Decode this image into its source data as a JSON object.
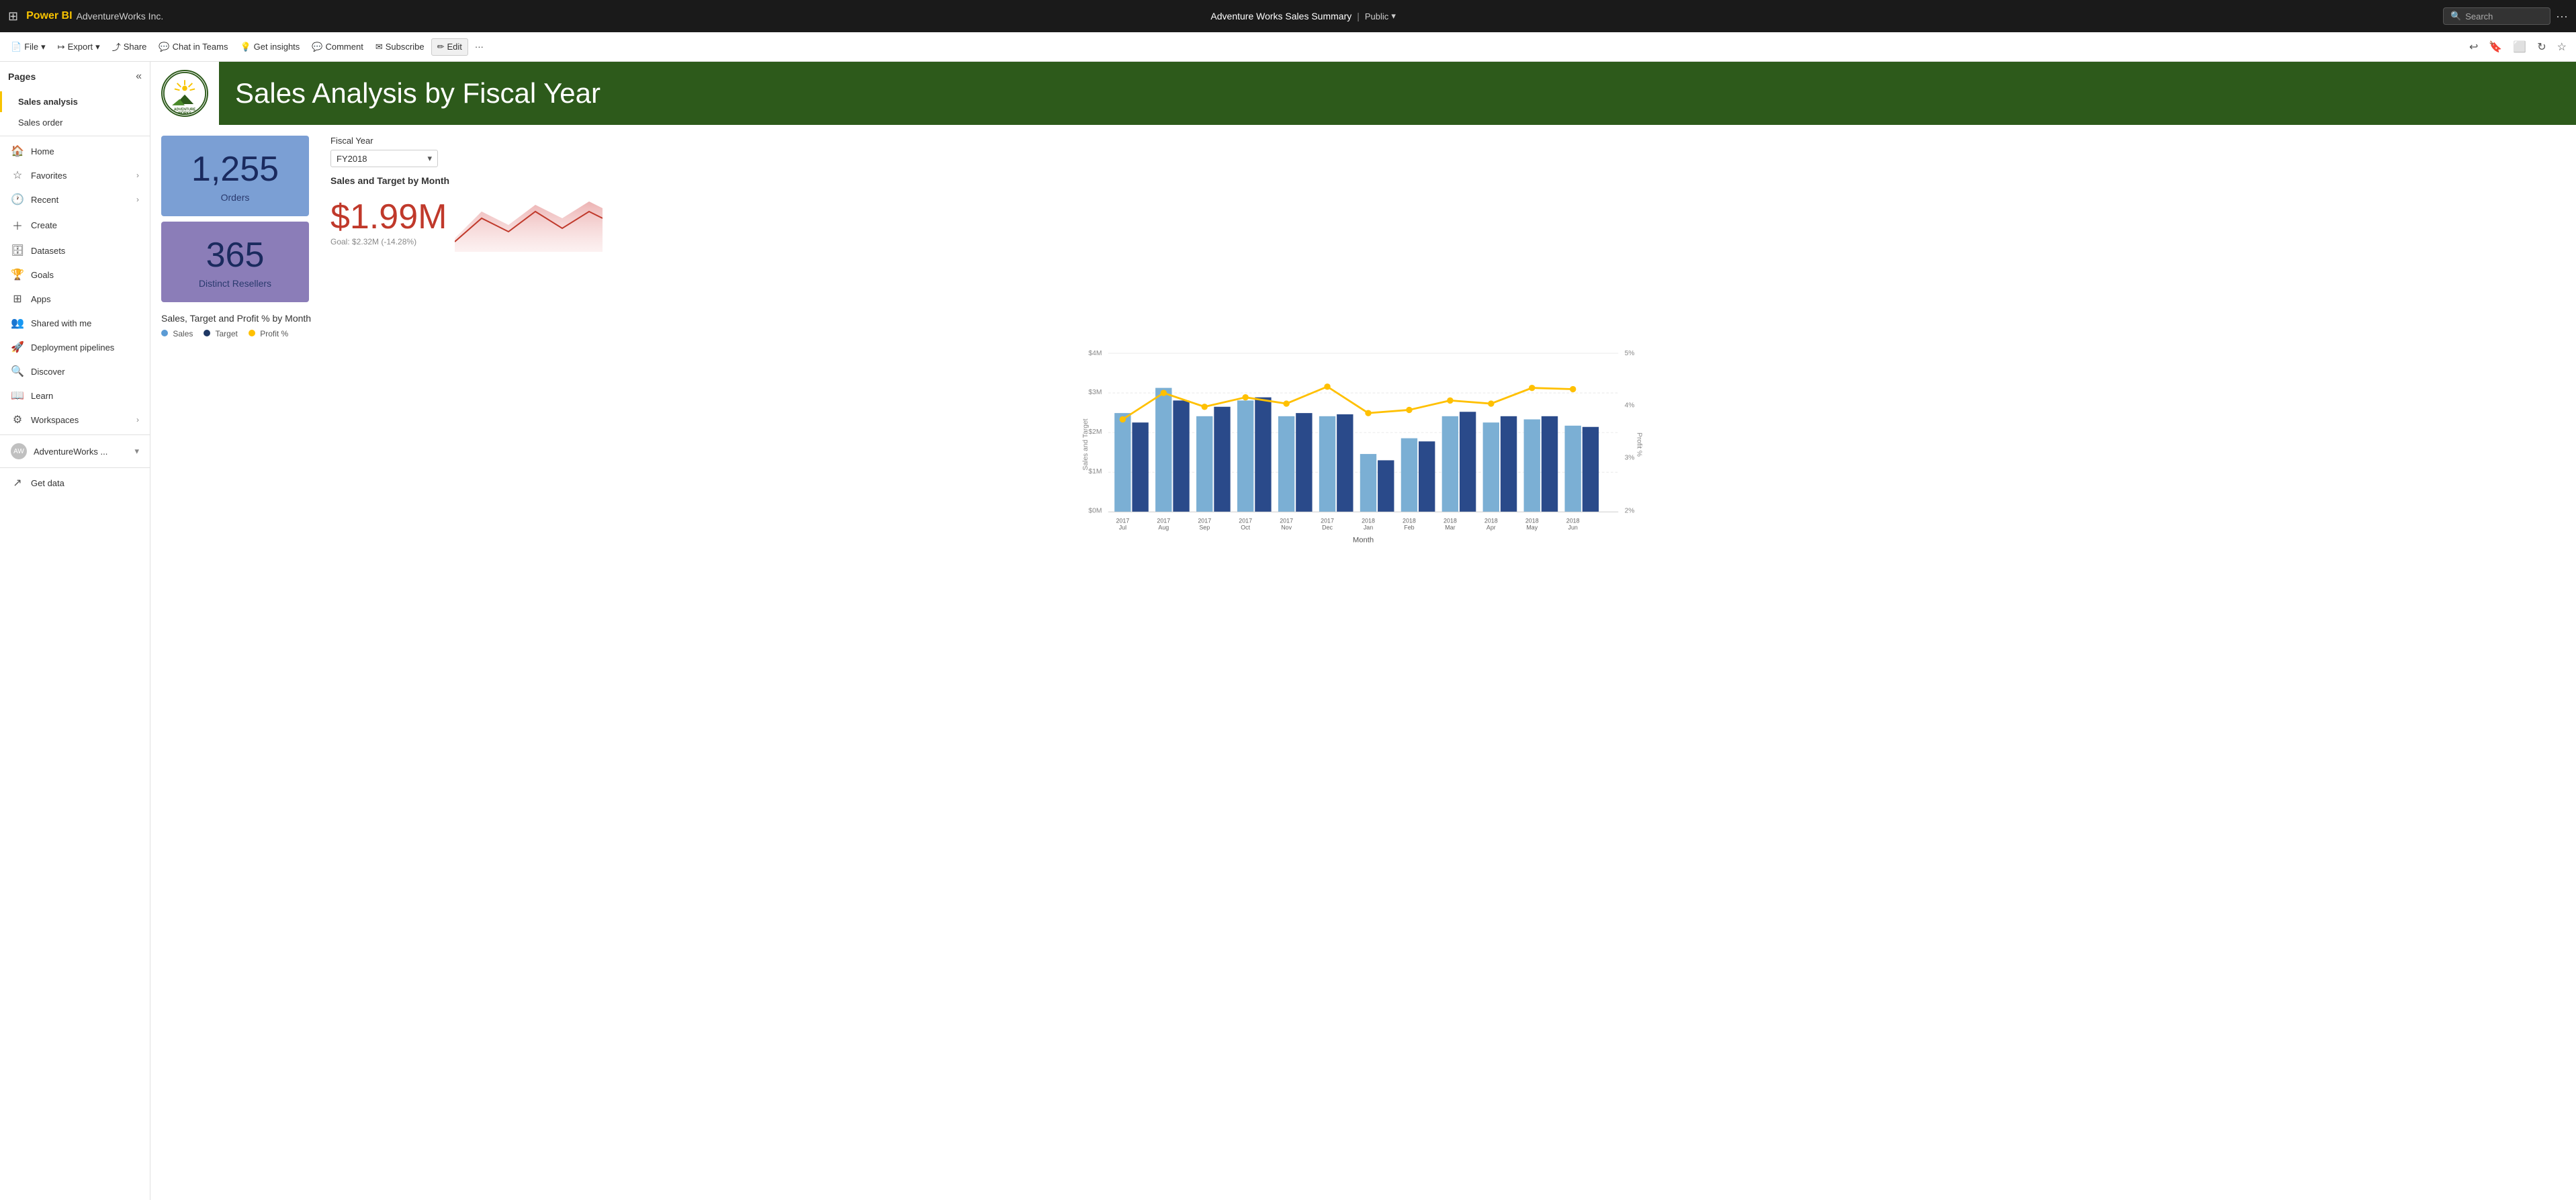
{
  "topbar": {
    "waffle_icon": "⊞",
    "logo_text": "Power BI",
    "org_name": "AdventureWorks Inc.",
    "report_title": "Adventure Works Sales Summary",
    "visibility": "Public",
    "search_placeholder": "Search",
    "more_icon": "···"
  },
  "toolbar": {
    "file_label": "File",
    "export_label": "Export",
    "share_label": "Share",
    "chat_label": "Chat in Teams",
    "insights_label": "Get insights",
    "comment_label": "Comment",
    "subscribe_label": "Subscribe",
    "edit_label": "Edit",
    "more_label": "···"
  },
  "pages_panel": {
    "title": "Pages",
    "pages": [
      {
        "label": "Sales analysis",
        "active": true
      },
      {
        "label": "Sales order",
        "active": false
      }
    ]
  },
  "sidebar": {
    "items": [
      {
        "label": "Home",
        "icon": "🏠",
        "has_arrow": false
      },
      {
        "label": "Favorites",
        "icon": "☆",
        "has_arrow": true
      },
      {
        "label": "Recent",
        "icon": "🕐",
        "has_arrow": true
      },
      {
        "label": "Create",
        "icon": "+",
        "has_arrow": false
      },
      {
        "label": "Datasets",
        "icon": "🗄",
        "has_arrow": false
      },
      {
        "label": "Goals",
        "icon": "🏆",
        "has_arrow": false
      },
      {
        "label": "Apps",
        "icon": "⊞",
        "has_arrow": false
      },
      {
        "label": "Shared with me",
        "icon": "👥",
        "has_arrow": false
      },
      {
        "label": "Deployment pipelines",
        "icon": "🚀",
        "has_arrow": false
      },
      {
        "label": "Discover",
        "icon": "🔍",
        "has_arrow": false
      },
      {
        "label": "Learn",
        "icon": "📖",
        "has_arrow": false
      },
      {
        "label": "Workspaces",
        "icon": "⚙",
        "has_arrow": true
      }
    ],
    "workspace_item": {
      "label": "AdventureWorks ...",
      "has_arrow": true
    },
    "get_data_label": "Get data"
  },
  "report": {
    "header": {
      "logo_text": "ADVENTURE WORKS",
      "title": "Sales Analysis by Fiscal Year"
    },
    "fiscal_year": {
      "label": "Fiscal Year",
      "value": "FY2018"
    },
    "kpis": [
      {
        "value": "1,255",
        "label": "Orders",
        "color": "#7b9fd4"
      },
      {
        "value": "365",
        "label": "Distinct Resellers",
        "color": "#8b7db8"
      }
    ],
    "sales_target": {
      "title": "Sales and Target by Month",
      "value": "$1.99M",
      "meta": "Goal: $2.32M (-14.28%)"
    },
    "chart": {
      "title": "Sales, Target and Profit % by Month",
      "legend": [
        {
          "label": "Sales",
          "color": "#5b9bd5"
        },
        {
          "label": "Target",
          "color": "#1f3864"
        },
        {
          "label": "Profit %",
          "color": "#ffc000"
        }
      ],
      "y_labels": [
        "$4M",
        "$3M",
        "$2M",
        "$1M",
        "$0M"
      ],
      "y2_labels": [
        "5%",
        "4%",
        "3%",
        "2%"
      ],
      "x_labels": [
        "2017 Jul",
        "2017 Aug",
        "2017 Sep",
        "2017 Oct",
        "2017 Nov",
        "2017 Dec",
        "2018 Jan",
        "2018 Feb",
        "2018 Mar",
        "2018 Apr",
        "2018 May",
        "2018 Jun"
      ],
      "x_axis_label": "Month",
      "y_axis_label": "Sales and Target",
      "y2_axis_label": "Profit %"
    }
  }
}
